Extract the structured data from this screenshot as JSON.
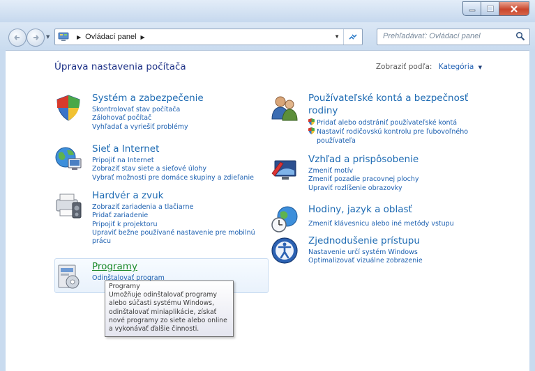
{
  "window": {
    "buttons": {
      "minimize": "minimize",
      "maximize": "maximize",
      "close": "close"
    }
  },
  "toolbar": {
    "address_segment": "Ovládací panel",
    "search_placeholder": "Prehľadávať: Ovládací panel"
  },
  "header": {
    "title": "Úprava nastavenia počítača",
    "view_by_label": "Zobraziť podľa:",
    "view_by_value": "Kategória"
  },
  "left_categories": [
    {
      "title": "Systém a zabezpečenie",
      "icon": "system-security-icon",
      "links": [
        "Skontrolovať stav počítača",
        "Zálohovať počítač",
        "Vyhľadať a vyriešiť problémy"
      ]
    },
    {
      "title": "Sieť a Internet",
      "icon": "network-icon",
      "links": [
        "Pripojiť na Internet",
        "Zobraziť stav siete a sieťové úlohy",
        "Vybrať možnosti pre domáce skupiny a zdieľanie"
      ]
    },
    {
      "title": "Hardvér a zvuk",
      "icon": "hardware-sound-icon",
      "links": [
        "Zobraziť zariadenia a tlačiarne",
        "Pridať zariadenie",
        "Pripojiť k projektoru",
        "Upraviť bežne používané nastavenie pre mobilnú prácu"
      ]
    },
    {
      "title": "Programy",
      "icon": "programs-icon",
      "links": [
        "Odinštalovať program"
      ]
    }
  ],
  "right_categories": [
    {
      "title": "Používateľské kontá a bezpečnosť rodiny",
      "icon": "user-accounts-icon",
      "links": [
        "Pridať alebo odstrániť používateľské kontá",
        "Nastaviť rodičovskú kontrolu pre ľubovoľného používateľa"
      ]
    },
    {
      "title": "Vzhľad a prispôsobenie",
      "icon": "appearance-icon",
      "links": [
        "Zmeniť motív",
        "Zmeniť pozadie pracovnej plochy",
        "Upraviť rozlíšenie obrazovky"
      ]
    },
    {
      "title": "Hodiny, jazyk a oblasť",
      "icon": "clock-language-icon",
      "links": [
        "Zmeniť klávesnicu alebo iné metódy vstupu"
      ]
    },
    {
      "title": "Zjednodušenie prístupu",
      "icon": "ease-of-access-icon",
      "links": [
        "Nastavenie určí systém Windows",
        "Optimalizovať vizuálne zobrazenie"
      ]
    }
  ],
  "tooltip": {
    "title": "Programy",
    "body": "Umožňuje odinštalovať programy alebo súčasti systému Windows, odinštalovať miniaplikácie, získať nové programy zo siete alebo online a vykonávať ďalšie činnosti."
  }
}
